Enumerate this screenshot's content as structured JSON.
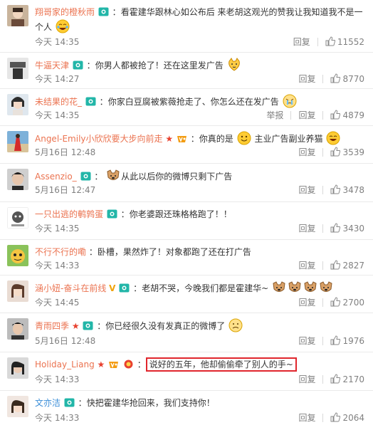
{
  "ui": {
    "reply_label": "回复",
    "report_label": "举报"
  },
  "comments": [
    {
      "user": "翔哥家的橙秋雨",
      "sep": "：",
      "text1": "看霍建华跟林心如公布后 来老胡这观光的赞我让我知道我不是一",
      "text2": "个人",
      "time": "今天 14:35",
      "likes": "11552"
    },
    {
      "user": "牛逼天津",
      "sep": "：",
      "text": "你男人都被抢了！还在这里发广告",
      "time": "今天 14:27",
      "likes": "8770"
    },
    {
      "user": "未结果的花_",
      "sep": "：",
      "text": "你家白豆腐被紫薇抢走了、你怎么还在发广告",
      "time": "今天 14:35",
      "likes": "4879"
    },
    {
      "user": "Angel-Emily小欣欣要大步向前走",
      "sep": "：",
      "text": "你真的是",
      "text_b": "主业广告副业养猫",
      "time": "5月16日 12:48",
      "likes": "3539"
    },
    {
      "user": "Assenzio_",
      "sep": "：",
      "text": "从此以后你的微博只剩下广告",
      "time": "5月16日 12:47",
      "likes": "3478"
    },
    {
      "user": "一只出逃的鹌鹑蛋",
      "sep": "：",
      "text": "你老婆跟还珠格格跑了！！",
      "time": "今天 14:35",
      "likes": "3430"
    },
    {
      "user": "不行不行的嘞",
      "sep": "：",
      "text": "卧槽，果然炸了！对象都跑了还在打广告",
      "time": "今天 14:33",
      "likes": "2827"
    },
    {
      "user": "涵小妞-奋斗在前线",
      "sep": "：",
      "text": "老胡不哭，今晚我们都是霍建华~",
      "time": "今天 14:45",
      "likes": "2700"
    },
    {
      "user": "青雨四季",
      "sep": "：",
      "text": "你已经很久没有发真正的微博了",
      "time": "5月16日 12:48",
      "likes": "1976"
    },
    {
      "user": "Holiday_Liang",
      "sep": "：",
      "text": "说好的五年，他却偷偷牵了别人的手~",
      "time": "今天 14:33",
      "likes": "2170"
    },
    {
      "user": "文亦洁",
      "sep": "：",
      "text": "快把霍建华抢回来，我们支持你！",
      "time": "今天 14:33",
      "likes": "2064"
    }
  ],
  "colors": {
    "username": "#eb7350",
    "username_alt": "#3b8ed8",
    "highlight_border": "#e0262d",
    "meta": "#808080"
  }
}
